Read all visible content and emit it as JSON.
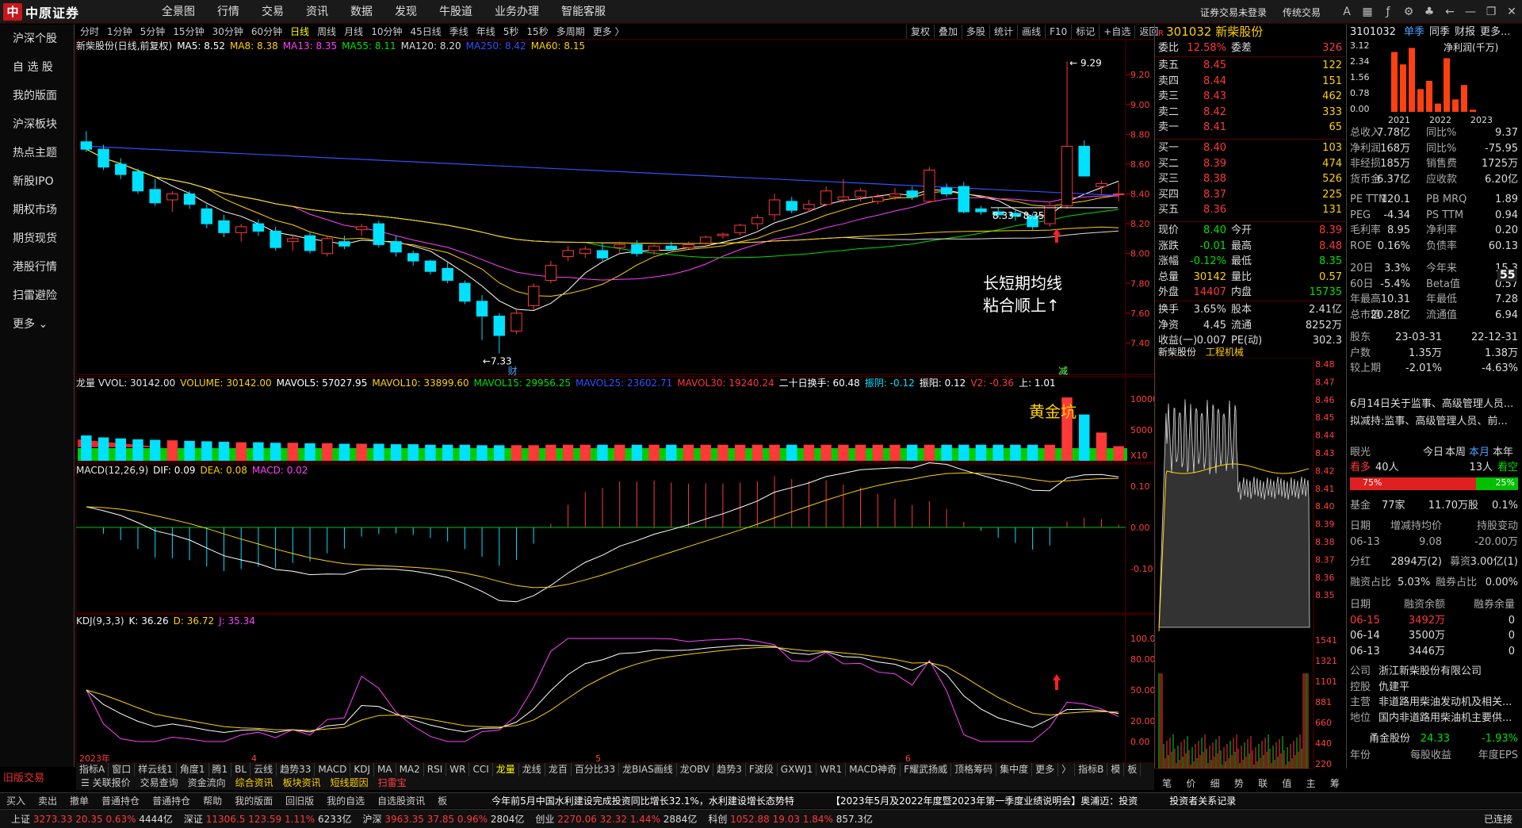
{
  "app": {
    "logo_mark": "中",
    "logo_text": "中原证券"
  },
  "menu": [
    "全景图",
    "行情",
    "交易",
    "资讯",
    "数据",
    "发现",
    "牛股道",
    "业务办理",
    "智能客服"
  ],
  "top_right": {
    "login": "证券交易未登录",
    "classic": "传统交易"
  },
  "sidebar": [
    "沪深个股",
    "自 选 股",
    "我的版面",
    "沪深板块",
    "热点主题",
    "新股IPO",
    "期权市场",
    "期货现货",
    "港股行情",
    "扫雷避险",
    "更多"
  ],
  "old_trade": "旧版交易",
  "periods": [
    "分时",
    "1分钟",
    "5分钟",
    "15分钟",
    "30分钟",
    "60分钟",
    "日线",
    "周线",
    "月线",
    "10分钟",
    "45日线",
    "季线",
    "年线",
    "5秒",
    "15秒",
    "多周期",
    "更多 〉"
  ],
  "period_active": "日线",
  "chart_tools": [
    "复权",
    "叠加",
    "多股",
    "统计",
    "画线",
    "F10",
    "标记",
    "+自选",
    "返回"
  ],
  "main_legend": {
    "name": "新柴股份(日线,前复权)",
    "items": [
      {
        "t": "MA5: 8.52",
        "c": "#ffffff"
      },
      {
        "t": "MA8: 8.38",
        "c": "#ffd000"
      },
      {
        "t": "MA13: 8.35",
        "c": "#ff40ff"
      },
      {
        "t": "MA55: 8.11",
        "c": "#00e000"
      },
      {
        "t": "MA120: 8.20",
        "c": "#dddddd"
      },
      {
        "t": "MA250: 8.42",
        "c": "#3050ff"
      },
      {
        "t": "MA60: 8.15",
        "c": "#ffd000"
      }
    ]
  },
  "vol_legend": {
    "name": "龙量 VVOL: 30142.00",
    "items": [
      {
        "t": "VOLUME: 30142.00",
        "c": "#ffd000"
      },
      {
        "t": "MAVOL5: 57027.95",
        "c": "#ffffff"
      },
      {
        "t": "MAVOL10: 33899.60",
        "c": "#ffd000"
      },
      {
        "t": "MAVOL15: 29956.25",
        "c": "#00e000"
      },
      {
        "t": "MAVOL25: 23602.71",
        "c": "#3050ff"
      },
      {
        "t": "MAVOL30: 19240.24",
        "c": "#ff3838"
      },
      {
        "t": "二十日换手: 60.48",
        "c": "#ffffff"
      },
      {
        "t": "振阴: -0.12",
        "c": "#00e0ff"
      },
      {
        "t": "振阳: 0.12",
        "c": "#ffffff"
      },
      {
        "t": "V2: -0.36",
        "c": "#ff3838"
      },
      {
        "t": "上: 1.01",
        "c": "#ffffff"
      }
    ]
  },
  "macd_legend": {
    "name": "MACD(12,26,9)",
    "items": [
      {
        "t": "DIF: 0.09",
        "c": "#ffffff"
      },
      {
        "t": "DEA: 0.08",
        "c": "#ffd000"
      },
      {
        "t": "MACD: 0.02",
        "c": "#ff40ff"
      }
    ]
  },
  "kdj_legend": {
    "name": "KDJ(9,3,3)",
    "items": [
      {
        "t": "K: 36.26",
        "c": "#ffffff"
      },
      {
        "t": "D: 36.72",
        "c": "#ffd000"
      },
      {
        "t": "J: 35.34",
        "c": "#ff40ff"
      }
    ]
  },
  "price_axis": [
    "9.20",
    "9.00",
    "8.80",
    "8.60",
    "8.40",
    "8.20",
    "8.00",
    "7.80",
    "7.60",
    "7.40"
  ],
  "vol_axis": [
    "10000",
    "5000",
    "X10"
  ],
  "macd_axis": [
    "0.10",
    "0.00",
    "-0.10"
  ],
  "kdj_axis": [
    "100.00",
    "80.00",
    "50.00",
    "20.00",
    "0.00"
  ],
  "annotations": {
    "high": "9.29",
    "low": "7.33",
    "range": "8.33 - 8.35",
    "cai": "财",
    "jian": "减",
    "note1": "长短期均线",
    "note2": "粘合顺上↑",
    "note3": "黄金坑"
  },
  "x_labels": [
    "2023年",
    "4",
    "5",
    "6"
  ],
  "indicator_tabs": [
    "指标A",
    "窗口",
    "样云线1",
    "角度1",
    "腾1",
    "BL",
    "云线",
    "趋势33",
    "MACD",
    "KDJ",
    "MA",
    "MA2",
    "RSI",
    "WR",
    "CCI",
    "龙量",
    "龙线",
    "龙百",
    "百分比33",
    "龙BIAS画线",
    "龙OBV",
    "趋势3",
    "F波段",
    "GXWJ1",
    "WR1",
    "MACD神奇",
    "F耀武扬威",
    "顶格筹码",
    "集中度",
    "更多",
    "〉"
  ],
  "indicator_active": "龙量",
  "indicator_tabs_right": [
    "指标B",
    "模",
    "板"
  ],
  "sub_tabs": [
    "关联报价",
    "交易查询",
    "资金流向",
    "综合资讯",
    "板块资讯",
    "短线题因",
    "扫雷宝"
  ],
  "quote": {
    "code": "301032",
    "name": "新柴股份",
    "weibi": [
      "委比",
      "12.58%",
      "委差",
      "326"
    ],
    "sell": [
      [
        "卖五",
        "8.45",
        "122"
      ],
      [
        "卖四",
        "8.44",
        "151"
      ],
      [
        "卖三",
        "8.43",
        "462"
      ],
      [
        "卖二",
        "8.42",
        "333"
      ],
      [
        "卖一",
        "8.41",
        "65"
      ]
    ],
    "buy": [
      [
        "买一",
        "8.40",
        "103"
      ],
      [
        "买二",
        "8.39",
        "474"
      ],
      [
        "买三",
        "8.38",
        "526"
      ],
      [
        "买四",
        "8.37",
        "225"
      ],
      [
        "买五",
        "8.36",
        "131"
      ]
    ],
    "info": [
      [
        "现价",
        "8.40",
        "今开",
        "8.39"
      ],
      [
        "涨跌",
        "-0.01",
        "最高",
        "8.48"
      ],
      [
        "涨幅",
        "-0.12%",
        "最低",
        "8.35"
      ],
      [
        "总量",
        "30142",
        "量比",
        "0.57"
      ],
      [
        "外盘",
        "14407",
        "内盘",
        "15735"
      ]
    ],
    "info2": [
      [
        "换手",
        "3.65%",
        "股本",
        "2.41亿"
      ],
      [
        "净资",
        "4.45",
        "流通",
        "8252万"
      ],
      [
        "收益(一)",
        "0.007",
        "PE(动)",
        "302.3"
      ]
    ]
  },
  "mini": {
    "tabs": [
      "新柴股份",
      "工程机械"
    ],
    "axis": [
      "8.48",
      "8.47",
      "8.46",
      "8.45",
      "8.44",
      "8.43",
      "8.42",
      "8.41",
      "8.40",
      "8.39",
      "8.38",
      "8.37",
      "8.36",
      "8.35"
    ],
    "vol_axis": [
      "1541",
      "1321",
      "1101",
      "881",
      "660",
      "440",
      "220"
    ]
  },
  "fin": {
    "code": "3101032",
    "tabs": [
      "单季",
      "同季",
      "财报",
      "更多..."
    ],
    "chart_title": "净利润(千万)",
    "y": [
      "3.12",
      "2.34",
      "1.56",
      "0.78",
      "0.00"
    ],
    "years": [
      "2021",
      "2022",
      "2023"
    ],
    "rows": [
      [
        "总收入",
        "7.78亿",
        "同比%",
        "9.37"
      ],
      [
        "净利润",
        "168万",
        "同比%",
        "-75.95"
      ],
      [
        "非经损",
        "185万",
        "销售费",
        "1725万"
      ],
      [
        "货币金",
        "6.37亿",
        "应收款",
        "6.20亿"
      ]
    ],
    "rows2": [
      [
        "PE TTM",
        "120.1",
        "PB MRQ",
        "1.89"
      ],
      [
        "PEG",
        "-4.34",
        "PS TTM",
        "0.94"
      ],
      [
        "毛利率",
        "8.95",
        "净利率",
        "0.20"
      ],
      [
        "ROE",
        "0.16%",
        "负债率",
        "60.13"
      ]
    ],
    "rows3": [
      [
        "20日",
        "3.3%",
        "今年来",
        "15.3"
      ],
      [
        "60日",
        "-5.4%",
        "Beta值",
        "0.57"
      ],
      [
        "年最高",
        "10.31",
        "年最低",
        "7.28"
      ],
      [
        "总市值",
        "20.28亿",
        "流通值",
        "6.94"
      ]
    ],
    "holders": [
      [
        "股东",
        "23-03-31",
        "22-12-31"
      ],
      [
        "户数",
        "1.35万",
        "1.38万"
      ],
      [
        "较上期",
        "-2.01%",
        "-4.63%"
      ]
    ],
    "news": [
      "6月14日关于监事、高级管理人员...",
      "拟减持:监事、高级管理人员、前..."
    ],
    "eye": [
      "眼光",
      "今日",
      "本周",
      "本月",
      "本年"
    ],
    "bull": [
      "看多",
      "40人",
      "13人",
      "看空"
    ],
    "bull_pct": [
      "75%",
      "25%"
    ],
    "fund": [
      "基金",
      "77家",
      "11.70万股",
      "0.1%"
    ],
    "pledge": [
      [
        "日期",
        "增减持均价",
        "持股变动"
      ],
      [
        "06-13",
        "9.08",
        "-20.00万"
      ]
    ],
    "div": [
      "分红",
      "2894万(2)",
      "募资",
      "3.00亿(1)"
    ],
    "margin": [
      "融资占比",
      "5.03%",
      "融券占比",
      "0.00%"
    ],
    "margin_rows": [
      [
        "日期",
        "融资余额",
        "融券余量"
      ],
      [
        "06-15",
        "3492万",
        "0"
      ],
      [
        "06-14",
        "3500万",
        "0"
      ],
      [
        "06-13",
        "3446万",
        "0"
      ]
    ],
    "company": [
      [
        "公司",
        "浙江新柴股份有限公司"
      ],
      [
        "控股",
        "仇建平"
      ],
      [
        "主营",
        "非道路用柴油发动机及相关..."
      ],
      [
        "地位",
        "国内非道路用柴油机主要供..."
      ]
    ],
    "bottom_stock": [
      "甬金股份",
      "24.33",
      "-1.93%"
    ],
    "bottom_hdr": [
      "年份",
      "每股收益",
      "年度EPS"
    ],
    "right_tabs": [
      "笔",
      "价",
      "细",
      "势",
      "联",
      "值",
      "主",
      "筹"
    ],
    "gap_label": "55"
  },
  "toolbar2": [
    "买入",
    "卖出",
    "撤单",
    "普通持仓",
    "普通持仓",
    "帮助",
    "我的版面",
    "回旧版",
    "我的自选",
    "自选股资讯",
    "板"
  ],
  "ticker": "今年前5月中国水利建设完成投资同比增长32.1%，水利建设增长态势特",
  "ticker2": "【2023年5月及2022年度暨2023年第一季度业绩说明会】奥浦迈：投资",
  "ticker3": "投资者关系记录",
  "status": [
    {
      "n": "上证",
      "v": "3273.33",
      "c": "20.35",
      "p": "0.63%",
      "a": "4444亿"
    },
    {
      "n": "深证",
      "v": "11306.5",
      "c": "123.59",
      "p": "1.11%",
      "a": "6233亿"
    },
    {
      "n": "沪深",
      "v": "3963.35",
      "c": "37.85",
      "p": "0.96%",
      "a": "2804亿"
    },
    {
      "n": "创业",
      "v": "2270.06",
      "c": "32.32",
      "p": "1.44%",
      "a": "2884亿"
    },
    {
      "n": "科创",
      "v": "1052.88",
      "c": "19.03",
      "p": "1.84%",
      "a": "857.3亿"
    }
  ],
  "connected": "已连接",
  "chart_data": {
    "type": "candlestick",
    "price_ylim": [
      7.33,
      9.29
    ],
    "candles": [
      [
        8.75,
        8.82,
        8.68,
        8.7
      ],
      [
        8.7,
        8.73,
        8.56,
        8.58
      ],
      [
        8.6,
        8.64,
        8.5,
        8.53
      ],
      [
        8.55,
        8.57,
        8.4,
        8.42
      ],
      [
        8.43,
        8.5,
        8.32,
        8.34
      ],
      [
        8.36,
        8.42,
        8.28,
        8.4
      ],
      [
        8.4,
        8.42,
        8.3,
        8.33
      ],
      [
        8.3,
        8.33,
        8.17,
        8.2
      ],
      [
        8.22,
        8.26,
        8.11,
        8.14
      ],
      [
        8.14,
        8.2,
        8.08,
        8.18
      ],
      [
        8.2,
        8.23,
        8.12,
        8.15
      ],
      [
        8.15,
        8.18,
        8.02,
        8.04
      ],
      [
        8.08,
        8.13,
        8.02,
        8.1
      ],
      [
        8.12,
        8.14,
        8.0,
        8.02
      ],
      [
        8.0,
        8.12,
        7.98,
        8.1
      ],
      [
        8.08,
        8.12,
        8.03,
        8.05
      ],
      [
        8.16,
        8.2,
        8.12,
        8.18
      ],
      [
        8.2,
        8.22,
        8.04,
        8.06
      ],
      [
        8.08,
        8.12,
        7.98,
        8.01
      ],
      [
        8.0,
        8.02,
        7.92,
        7.95
      ],
      [
        7.95,
        7.96,
        7.86,
        7.88
      ],
      [
        7.9,
        7.94,
        7.8,
        7.82
      ],
      [
        7.8,
        7.82,
        7.66,
        7.68
      ],
      [
        7.68,
        7.72,
        7.42,
        7.58
      ],
      [
        7.58,
        7.6,
        7.33,
        7.45
      ],
      [
        7.48,
        7.62,
        7.46,
        7.6
      ],
      [
        7.65,
        7.8,
        7.62,
        7.78
      ],
      [
        7.82,
        7.95,
        7.8,
        7.92
      ],
      [
        7.98,
        8.05,
        7.95,
        8.02
      ],
      [
        8.0,
        8.05,
        7.97,
        8.03
      ],
      [
        8.02,
        8.07,
        7.95,
        7.97
      ],
      [
        8.04,
        8.08,
        8.0,
        8.06
      ],
      [
        8.06,
        8.09,
        7.98,
        8.0
      ],
      [
        8.02,
        8.06,
        7.99,
        8.05
      ],
      [
        8.05,
        8.08,
        8.02,
        8.03
      ],
      [
        8.04,
        8.08,
        8.03,
        8.06
      ],
      [
        8.07,
        8.12,
        8.06,
        8.11
      ],
      [
        8.12,
        8.14,
        8.1,
        8.13
      ],
      [
        8.14,
        8.2,
        8.12,
        8.19
      ],
      [
        8.2,
        8.26,
        8.16,
        8.24
      ],
      [
        8.26,
        8.4,
        8.22,
        8.36
      ],
      [
        8.35,
        8.38,
        8.27,
        8.29
      ],
      [
        8.3,
        8.36,
        8.28,
        8.33
      ],
      [
        8.33,
        8.45,
        8.32,
        8.42
      ],
      [
        8.36,
        8.5,
        8.34,
        8.38
      ],
      [
        8.38,
        8.44,
        8.35,
        8.42
      ],
      [
        8.35,
        8.4,
        8.33,
        8.38
      ],
      [
        8.38,
        8.44,
        8.36,
        8.4
      ],
      [
        8.42,
        8.45,
        8.36,
        8.38
      ],
      [
        8.35,
        8.58,
        8.34,
        8.56
      ],
      [
        8.44,
        8.47,
        8.38,
        8.4
      ],
      [
        8.45,
        8.48,
        8.27,
        8.28
      ],
      [
        8.3,
        8.32,
        8.26,
        8.28
      ],
      [
        8.28,
        8.31,
        8.24,
        8.26
      ],
      [
        8.27,
        8.29,
        8.22,
        8.25
      ],
      [
        8.25,
        8.27,
        8.16,
        8.18
      ],
      [
        8.2,
        8.34,
        8.18,
        8.32
      ],
      [
        8.32,
        9.29,
        8.3,
        8.72
      ],
      [
        8.72,
        8.76,
        8.52,
        8.52
      ],
      [
        8.45,
        8.49,
        8.4,
        8.47
      ],
      [
        8.4,
        8.48,
        8.35,
        8.4
      ]
    ],
    "volume": [
      5200,
      4800,
      4600,
      4400,
      4300,
      4200,
      4100,
      4000,
      3900,
      3800,
      3800,
      3700,
      3700,
      3600,
      3600,
      3500,
      3500,
      3500,
      3400,
      3400,
      3300,
      3300,
      3300,
      3200,
      3200,
      3200,
      3200,
      3300,
      3300,
      3300,
      3300,
      3300,
      3300,
      3300,
      3300,
      3300,
      3300,
      3300,
      3300,
      3300,
      3300,
      3300,
      3300,
      3300,
      3300,
      3300,
      3300,
      3300,
      3300,
      3300,
      3300,
      3300,
      3300,
      3300,
      3300,
      3300,
      3300,
      13000,
      9500,
      5800,
      3000
    ],
    "fin_bars": [
      2.9,
      2.3,
      3.1,
      1.1,
      1.5,
      0.4,
      2.6,
      0.6,
      1.3,
      0.1
    ]
  }
}
